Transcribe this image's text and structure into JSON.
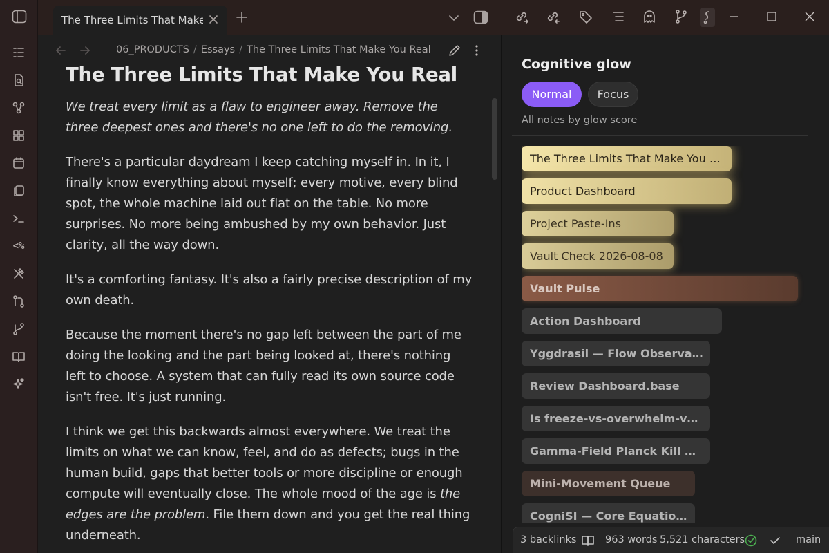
{
  "tab": {
    "title": "The Three Limits That Make You R...",
    "full_title": "The Three Limits That Make You Real"
  },
  "breadcrumb": {
    "folder": "06_PRODUCTS",
    "subfolder": "Essays",
    "current": "The Three Limits That Make You Real",
    "separator": "/"
  },
  "document": {
    "title": "The Three Limits That Make You Real",
    "lede": "We treat every limit as a flaw to engineer away. Remove the three deepest ones and there's no one left to do the removing.",
    "p1": "There's a particular daydream I keep catching myself in. In it, I finally know everything about myself; every motive, every blind spot, the whole machine laid out flat on the table. No more surprises. No more being ambushed by my own behavior. Just clarity, all the way down.",
    "p2": "It's a comforting fantasy. It's also a fairly precise description of my own death.",
    "p3": "Because the moment there's no gap left between the part of me doing the looking and the part being looked at, there's nothing left to choose. A system that can fully read its own source code isn't free. It's just running.",
    "p4_start": "I think we get this backwards almost everywhere. We treat the limits on what we can know, feel, and do as defects; bugs in the human build, gaps that better tools or more discipline or enough compute will eventually close. The whole mood of the age is ",
    "p4_em": "the edges are the problem",
    "p4_end": ". File them down and you get the real thing underneath."
  },
  "panel": {
    "title": "Cognitive glow",
    "modes": {
      "normal": "Normal",
      "focus": "Focus",
      "active": "normal"
    },
    "subtitle": "All notes by glow score",
    "items": [
      {
        "label": "The Three Limits That Make You R...",
        "glow": 1.0,
        "tone": "gold"
      },
      {
        "label": "Product Dashboard",
        "glow": 0.95,
        "tone": "gold"
      },
      {
        "label": "Project Paste-Ins",
        "glow": 0.75,
        "tone": "gold"
      },
      {
        "label": "Vault Check 2026-08-08",
        "glow": 0.7,
        "tone": "gold"
      },
      {
        "label": "Vault Pulse",
        "glow": 0.55,
        "tone": "copper"
      },
      {
        "label": "Action Dashboard",
        "glow": 0.3,
        "tone": "grey"
      },
      {
        "label": "Yggdrasil — Flow Observatory",
        "glow": 0.28,
        "tone": "grey"
      },
      {
        "label": "Review Dashboard.base",
        "glow": 0.28,
        "tone": "grey"
      },
      {
        "label": "Is freeze-vs-overwhelm-vs-stu...",
        "glow": 0.28,
        "tone": "grey"
      },
      {
        "label": "Gamma-Field Planck Kill Shot ...",
        "glow": 0.28,
        "tone": "grey"
      },
      {
        "label": "Mini-Movement Queue",
        "glow": 0.26,
        "tone": "brown"
      },
      {
        "label": "CogniSI — Core Equations ...",
        "glow": 0.26,
        "tone": "grey"
      }
    ]
  },
  "status": {
    "backlinks": "3 backlinks",
    "words": "963 words",
    "characters": "5,521 characters",
    "branch": "main"
  },
  "colors": {
    "accent": "#8b5cf6",
    "gold": "#f2e2a6",
    "copper": "#7a5040",
    "sync_ok": "#4caf50"
  },
  "icons": {
    "ribbon": [
      "files-icon",
      "search-doc-icon",
      "graph-icon",
      "dashboard-icon",
      "calendar-icon",
      "copy-icon",
      "terminal-icon",
      "percent-code-icon",
      "tools-icon",
      "git-compare-icon",
      "git-branch-icon",
      "book-icon",
      "sparkle-icon"
    ],
    "rightbar": [
      "link-out-icon",
      "link-in-icon",
      "tag-icon",
      "outline-icon",
      "ghost-icon",
      "git-icon",
      "glow-icon"
    ]
  }
}
